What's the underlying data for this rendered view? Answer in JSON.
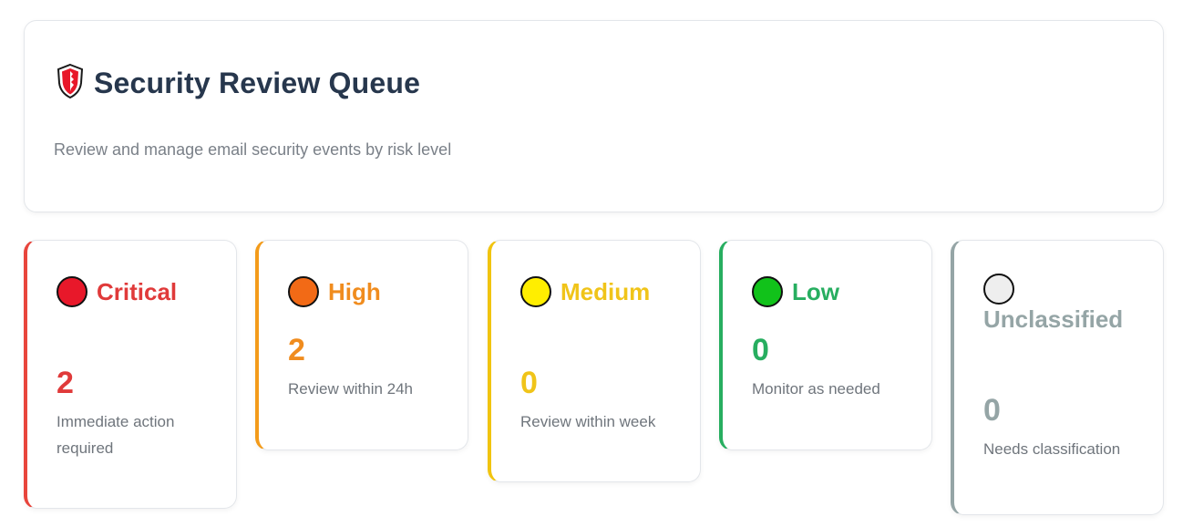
{
  "header": {
    "title": "Security Review Queue",
    "subtitle": "Review and manage email security events by risk level",
    "icon": "shield-icon"
  },
  "cards": [
    {
      "key": "critical",
      "label": "Critical",
      "count": "2",
      "description": "Immediate action required",
      "color": "#e03a3a",
      "border": "#e8453c",
      "dot": "#e8182a"
    },
    {
      "key": "high",
      "label": "High",
      "count": "2",
      "description": "Review within 24h",
      "color": "#f08c1e",
      "border": "#f39b1a",
      "dot": "#f26a16"
    },
    {
      "key": "medium",
      "label": "Medium",
      "count": "0",
      "description": "Review within week",
      "color": "#f0c419",
      "border": "#f1c40f",
      "dot": "#ffee00"
    },
    {
      "key": "low",
      "label": "Low",
      "count": "0",
      "description": "Monitor as needed",
      "color": "#27ae60",
      "border": "#27ae60",
      "dot": "#11c21a"
    },
    {
      "key": "unclassified",
      "label": "Unclassified",
      "count": "0",
      "description": "Needs classification",
      "color": "#95a5a6",
      "border": "#95a5a6",
      "dot": "#eeeeee"
    }
  ]
}
